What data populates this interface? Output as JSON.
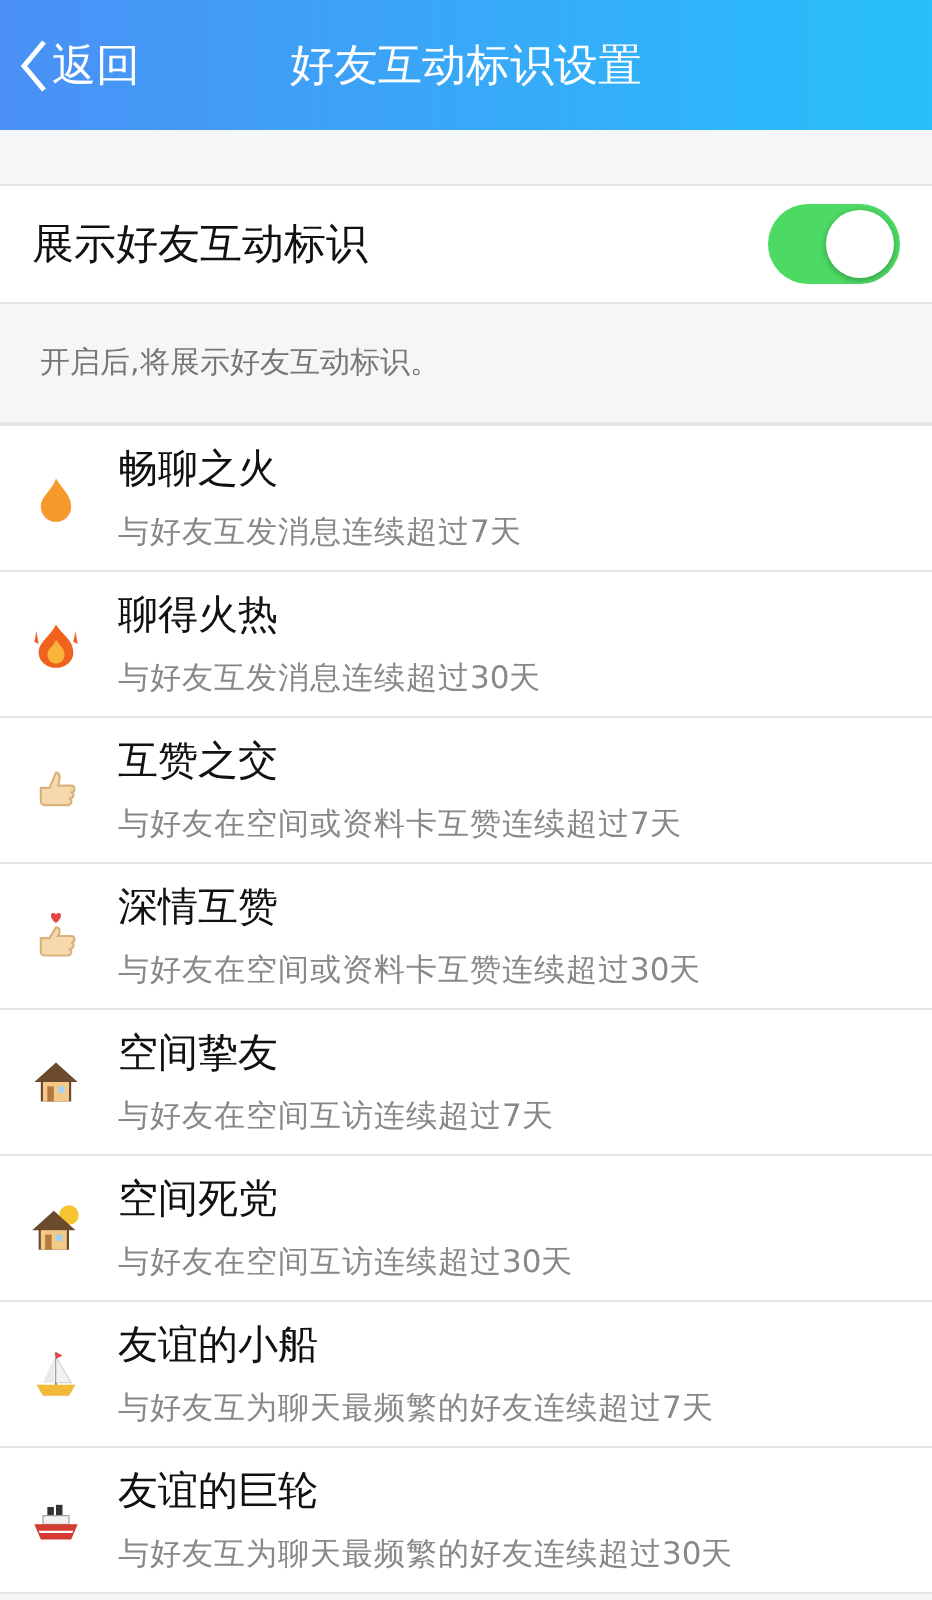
{
  "header": {
    "back": "返回",
    "title": "好友互动标识设置"
  },
  "toggle": {
    "label": "展示好友互动标识",
    "on": true
  },
  "hint": "开启后,将展示好友互动标识。",
  "badges": [
    {
      "kind": "flame",
      "name": "畅聊之火",
      "desc": "与好友互发消息连续超过7天"
    },
    {
      "kind": "flames",
      "name": "聊得火热",
      "desc": "与好友互发消息连续超过30天"
    },
    {
      "kind": "thumb",
      "name": "互赞之交",
      "desc": "与好友在空间或资料卡互赞连续超过7天"
    },
    {
      "kind": "thumb-heart",
      "name": "深情互赞",
      "desc": "与好友在空间或资料卡互赞连续超过30天"
    },
    {
      "kind": "house",
      "name": "空间挚友",
      "desc": "与好友在空间互访连续超过7天"
    },
    {
      "kind": "house-sun",
      "name": "空间死党",
      "desc": "与好友在空间互访连续超过30天"
    },
    {
      "kind": "sailboat",
      "name": "友谊的小船",
      "desc": "与好友互为聊天最频繁的好友连续超过7天"
    },
    {
      "kind": "ship",
      "name": "友谊的巨轮",
      "desc": "与好友互为聊天最频繁的好友连续超过30天"
    }
  ]
}
